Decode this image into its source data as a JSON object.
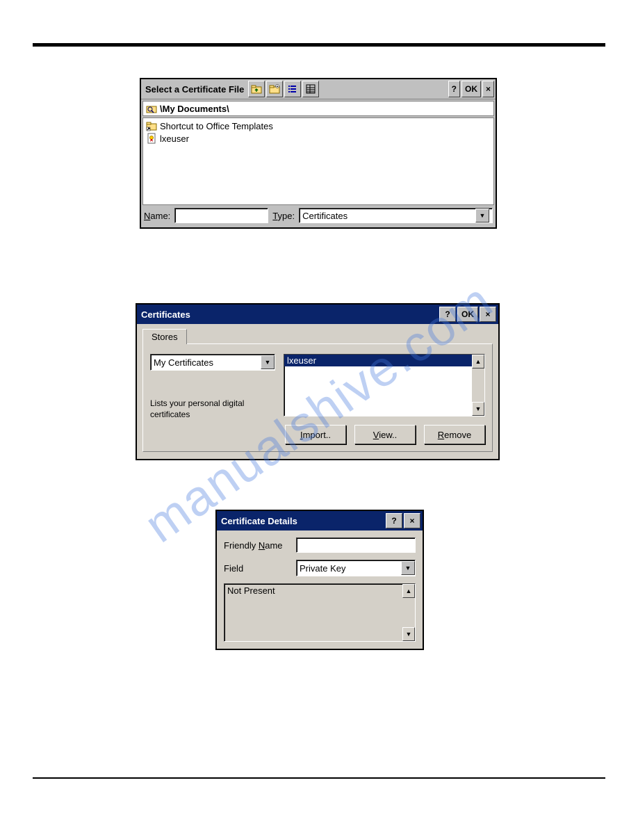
{
  "dialog1": {
    "title": "Select a Certificate File",
    "help": "?",
    "ok": "OK",
    "close": "×",
    "path": "\\My Documents\\",
    "files": [
      {
        "name": "Shortcut to Office Templates",
        "icon": "folder-shortcut"
      },
      {
        "name": "lxeuser",
        "icon": "cert-file"
      }
    ],
    "name_label": "Name:",
    "name_value": "",
    "type_label": "Type:",
    "type_value": "Certificates"
  },
  "dialog2": {
    "title": "Certificates",
    "help": "?",
    "ok": "OK",
    "close": "×",
    "tab": "Stores",
    "store_selected": "My Certificates",
    "description": "Lists your personal digital certificates",
    "list": [
      "lxeuser"
    ],
    "buttons": {
      "import": "Import..",
      "view": "View..",
      "remove": "Remove"
    }
  },
  "dialog3": {
    "title": "Certificate Details",
    "help": "?",
    "close": "×",
    "friendly_label": "Friendly Name",
    "friendly_value": "",
    "field_label": "Field",
    "field_value": "Private Key",
    "details_value": "Not Present"
  },
  "watermark": "manualshive.com"
}
